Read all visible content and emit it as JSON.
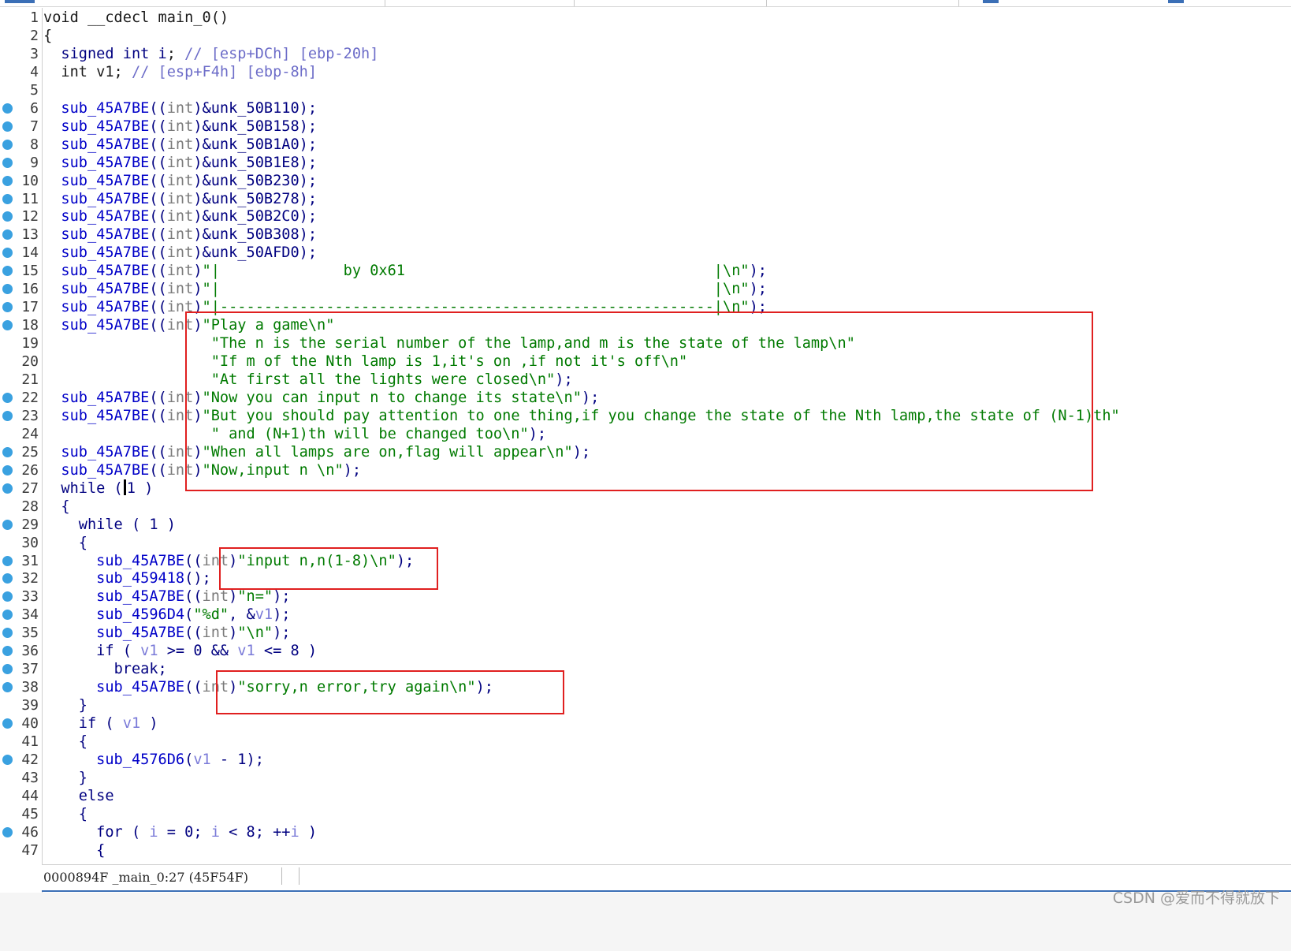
{
  "editor": {
    "lines": [
      {
        "n": "1",
        "bp": false,
        "t": [
          [
            "c-def",
            "void __cdecl main_0()"
          ]
        ]
      },
      {
        "n": "2",
        "bp": false,
        "t": [
          [
            "c-def",
            "{"
          ]
        ]
      },
      {
        "n": "3",
        "bp": false,
        "t": [
          [
            "c-def",
            "  "
          ],
          [
            "c-kw",
            "signed int i"
          ],
          [
            "c-def",
            "; "
          ],
          [
            "c-cm",
            "// [esp+DCh] [ebp-20h]"
          ]
        ]
      },
      {
        "n": "4",
        "bp": false,
        "t": [
          [
            "c-def",
            "  int v1; "
          ],
          [
            "c-cm",
            "// [esp+F4h] [ebp-8h]"
          ]
        ]
      },
      {
        "n": "5",
        "bp": false,
        "t": [
          [
            "c-def",
            ""
          ]
        ]
      },
      {
        "n": "6",
        "bp": true,
        "t": [
          [
            "c-def",
            "  "
          ],
          [
            "c-fn",
            "sub_45A7BE"
          ],
          [
            "c-kw",
            "(("
          ],
          [
            "c-tp",
            "int"
          ],
          [
            "c-kw",
            ")&unk_50B110);"
          ]
        ]
      },
      {
        "n": "7",
        "bp": true,
        "t": [
          [
            "c-def",
            "  "
          ],
          [
            "c-fn",
            "sub_45A7BE"
          ],
          [
            "c-kw",
            "(("
          ],
          [
            "c-tp",
            "int"
          ],
          [
            "c-kw",
            ")&unk_50B158);"
          ]
        ]
      },
      {
        "n": "8",
        "bp": true,
        "t": [
          [
            "c-def",
            "  "
          ],
          [
            "c-fn",
            "sub_45A7BE"
          ],
          [
            "c-kw",
            "(("
          ],
          [
            "c-tp",
            "int"
          ],
          [
            "c-kw",
            ")&unk_50B1A0);"
          ]
        ]
      },
      {
        "n": "9",
        "bp": true,
        "t": [
          [
            "c-def",
            "  "
          ],
          [
            "c-fn",
            "sub_45A7BE"
          ],
          [
            "c-kw",
            "(("
          ],
          [
            "c-tp",
            "int"
          ],
          [
            "c-kw",
            ")&unk_50B1E8);"
          ]
        ]
      },
      {
        "n": "10",
        "bp": true,
        "t": [
          [
            "c-def",
            "  "
          ],
          [
            "c-fn",
            "sub_45A7BE"
          ],
          [
            "c-kw",
            "(("
          ],
          [
            "c-tp",
            "int"
          ],
          [
            "c-kw",
            ")&unk_50B230);"
          ]
        ]
      },
      {
        "n": "11",
        "bp": true,
        "t": [
          [
            "c-def",
            "  "
          ],
          [
            "c-fn",
            "sub_45A7BE"
          ],
          [
            "c-kw",
            "(("
          ],
          [
            "c-tp",
            "int"
          ],
          [
            "c-kw",
            ")&unk_50B278);"
          ]
        ]
      },
      {
        "n": "12",
        "bp": true,
        "t": [
          [
            "c-def",
            "  "
          ],
          [
            "c-fn",
            "sub_45A7BE"
          ],
          [
            "c-kw",
            "(("
          ],
          [
            "c-tp",
            "int"
          ],
          [
            "c-kw",
            ")&unk_50B2C0);"
          ]
        ]
      },
      {
        "n": "13",
        "bp": true,
        "t": [
          [
            "c-def",
            "  "
          ],
          [
            "c-fn",
            "sub_45A7BE"
          ],
          [
            "c-kw",
            "(("
          ],
          [
            "c-tp",
            "int"
          ],
          [
            "c-kw",
            ")&unk_50B308);"
          ]
        ]
      },
      {
        "n": "14",
        "bp": true,
        "t": [
          [
            "c-def",
            "  "
          ],
          [
            "c-fn",
            "sub_45A7BE"
          ],
          [
            "c-kw",
            "(("
          ],
          [
            "c-tp",
            "int"
          ],
          [
            "c-kw",
            ")&unk_50AFD0);"
          ]
        ]
      },
      {
        "n": "15",
        "bp": true,
        "t": [
          [
            "c-def",
            "  "
          ],
          [
            "c-fn",
            "sub_45A7BE"
          ],
          [
            "c-kw",
            "(("
          ],
          [
            "c-tp",
            "int"
          ],
          [
            "c-kw",
            ")"
          ],
          [
            "c-st",
            "\"|              by 0x61                                   |\\n\""
          ],
          [
            "c-kw",
            ");"
          ]
        ]
      },
      {
        "n": "16",
        "bp": true,
        "t": [
          [
            "c-def",
            "  "
          ],
          [
            "c-fn",
            "sub_45A7BE"
          ],
          [
            "c-kw",
            "(("
          ],
          [
            "c-tp",
            "int"
          ],
          [
            "c-kw",
            ")"
          ],
          [
            "c-st",
            "\"|                                                        |\\n\""
          ],
          [
            "c-kw",
            ");"
          ]
        ]
      },
      {
        "n": "17",
        "bp": true,
        "t": [
          [
            "c-def",
            "  "
          ],
          [
            "c-fn",
            "sub_45A7BE"
          ],
          [
            "c-kw",
            "(("
          ],
          [
            "c-tp",
            "int"
          ],
          [
            "c-kw",
            ")"
          ],
          [
            "c-st",
            "\"|--------------------------------------------------------|\\n\""
          ],
          [
            "c-kw",
            ");"
          ]
        ]
      },
      {
        "n": "18",
        "bp": true,
        "t": [
          [
            "c-def",
            "  "
          ],
          [
            "c-fn",
            "sub_45A7BE"
          ],
          [
            "c-kw",
            "(("
          ],
          [
            "c-tp",
            "int"
          ],
          [
            "c-kw",
            ")"
          ],
          [
            "c-st",
            "\"Play a game\\n\""
          ]
        ]
      },
      {
        "n": "19",
        "bp": false,
        "t": [
          [
            "c-def",
            "                   "
          ],
          [
            "c-st",
            "\"The n is the serial number of the lamp,and m is the state of the lamp\\n\""
          ]
        ]
      },
      {
        "n": "20",
        "bp": false,
        "t": [
          [
            "c-def",
            "                   "
          ],
          [
            "c-st",
            "\"If m of the Nth lamp is 1,it's on ,if not it's off\\n\""
          ]
        ]
      },
      {
        "n": "21",
        "bp": false,
        "t": [
          [
            "c-def",
            "                   "
          ],
          [
            "c-st",
            "\"At first all the lights were closed\\n\""
          ],
          [
            "c-kw",
            ");"
          ]
        ]
      },
      {
        "n": "22",
        "bp": true,
        "t": [
          [
            "c-def",
            "  "
          ],
          [
            "c-fn",
            "sub_45A7BE"
          ],
          [
            "c-kw",
            "(("
          ],
          [
            "c-tp",
            "int"
          ],
          [
            "c-kw",
            ")"
          ],
          [
            "c-st",
            "\"Now you can input n to change its state\\n\""
          ],
          [
            "c-kw",
            ");"
          ]
        ]
      },
      {
        "n": "23",
        "bp": true,
        "t": [
          [
            "c-def",
            "  "
          ],
          [
            "c-fn",
            "sub_45A7BE"
          ],
          [
            "c-kw",
            "(("
          ],
          [
            "c-tp",
            "int"
          ],
          [
            "c-kw",
            ")"
          ],
          [
            "c-st",
            "\"But you should pay attention to one thing,if you change the state of the Nth lamp,the state of (N-1)th\""
          ]
        ]
      },
      {
        "n": "24",
        "bp": false,
        "t": [
          [
            "c-def",
            "                   "
          ],
          [
            "c-st",
            "\" and (N+1)th will be changed too\\n\""
          ],
          [
            "c-kw",
            ");"
          ]
        ]
      },
      {
        "n": "25",
        "bp": true,
        "t": [
          [
            "c-def",
            "  "
          ],
          [
            "c-fn",
            "sub_45A7BE"
          ],
          [
            "c-kw",
            "(("
          ],
          [
            "c-tp",
            "int"
          ],
          [
            "c-kw",
            ")"
          ],
          [
            "c-st",
            "\"When all lamps are on,flag will appear\\n\""
          ],
          [
            "c-kw",
            ");"
          ]
        ]
      },
      {
        "n": "26",
        "bp": true,
        "t": [
          [
            "c-def",
            "  "
          ],
          [
            "c-fn",
            "sub_45A7BE"
          ],
          [
            "c-kw",
            "(("
          ],
          [
            "c-tp",
            "int"
          ],
          [
            "c-kw",
            ")"
          ],
          [
            "c-st",
            "\"Now,input n \\n\""
          ],
          [
            "c-kw",
            ");"
          ]
        ]
      },
      {
        "n": "27",
        "bp": true,
        "cursor": true,
        "t": [
          [
            "c-def",
            "  "
          ],
          [
            "c-kw",
            "while ("
          ],
          [
            "cursor",
            ""
          ],
          [
            "c-kw",
            "1 )"
          ]
        ]
      },
      {
        "n": "28",
        "bp": false,
        "t": [
          [
            "c-def",
            "  "
          ],
          [
            "c-kw",
            "{"
          ]
        ]
      },
      {
        "n": "29",
        "bp": true,
        "t": [
          [
            "c-def",
            "    "
          ],
          [
            "c-kw",
            "while ( 1 )"
          ]
        ]
      },
      {
        "n": "30",
        "bp": false,
        "t": [
          [
            "c-def",
            "    "
          ],
          [
            "c-kw",
            "{"
          ]
        ]
      },
      {
        "n": "31",
        "bp": true,
        "t": [
          [
            "c-def",
            "      "
          ],
          [
            "c-fn",
            "sub_45A7BE"
          ],
          [
            "c-kw",
            "(("
          ],
          [
            "c-tp",
            "int"
          ],
          [
            "c-kw",
            ")"
          ],
          [
            "c-st",
            "\"input n,n(1-8)\\n\""
          ],
          [
            "c-kw",
            ");"
          ]
        ]
      },
      {
        "n": "32",
        "bp": true,
        "t": [
          [
            "c-def",
            "      "
          ],
          [
            "c-fn",
            "sub_459418"
          ],
          [
            "c-kw",
            "();"
          ]
        ]
      },
      {
        "n": "33",
        "bp": true,
        "t": [
          [
            "c-def",
            "      "
          ],
          [
            "c-fn",
            "sub_45A7BE"
          ],
          [
            "c-kw",
            "(("
          ],
          [
            "c-tp",
            "int"
          ],
          [
            "c-kw",
            ")"
          ],
          [
            "c-st",
            "\"n=\""
          ],
          [
            "c-kw",
            ");"
          ]
        ]
      },
      {
        "n": "34",
        "bp": true,
        "t": [
          [
            "c-def",
            "      "
          ],
          [
            "c-fn",
            "sub_4596D4"
          ],
          [
            "c-kw",
            "("
          ],
          [
            "c-st",
            "\"%d\""
          ],
          [
            "c-kw",
            ", &"
          ],
          [
            "c-v",
            "v1"
          ],
          [
            "c-kw",
            ");"
          ]
        ]
      },
      {
        "n": "35",
        "bp": true,
        "t": [
          [
            "c-def",
            "      "
          ],
          [
            "c-fn",
            "sub_45A7BE"
          ],
          [
            "c-kw",
            "(("
          ],
          [
            "c-tp",
            "int"
          ],
          [
            "c-kw",
            ")"
          ],
          [
            "c-st",
            "\"\\n\""
          ],
          [
            "c-kw",
            ");"
          ]
        ]
      },
      {
        "n": "36",
        "bp": true,
        "t": [
          [
            "c-def",
            "      "
          ],
          [
            "c-kw",
            "if ( "
          ],
          [
            "c-v",
            "v1"
          ],
          [
            "c-kw",
            " >= 0 && "
          ],
          [
            "c-v",
            "v1"
          ],
          [
            "c-kw",
            " <= 8 )"
          ]
        ]
      },
      {
        "n": "37",
        "bp": true,
        "t": [
          [
            "c-def",
            "        "
          ],
          [
            "c-kw",
            "break;"
          ]
        ]
      },
      {
        "n": "38",
        "bp": true,
        "t": [
          [
            "c-def",
            "      "
          ],
          [
            "c-fn",
            "sub_45A7BE"
          ],
          [
            "c-kw",
            "(("
          ],
          [
            "c-tp",
            "int"
          ],
          [
            "c-kw",
            ")"
          ],
          [
            "c-st",
            "\"sorry,n error,try again\\n\""
          ],
          [
            "c-kw",
            ");"
          ]
        ]
      },
      {
        "n": "39",
        "bp": false,
        "t": [
          [
            "c-def",
            "    "
          ],
          [
            "c-kw",
            "}"
          ]
        ]
      },
      {
        "n": "40",
        "bp": true,
        "t": [
          [
            "c-def",
            "    "
          ],
          [
            "c-kw",
            "if ( "
          ],
          [
            "c-v",
            "v1"
          ],
          [
            "c-kw",
            " )"
          ]
        ]
      },
      {
        "n": "41",
        "bp": false,
        "t": [
          [
            "c-def",
            "    "
          ],
          [
            "c-kw",
            "{"
          ]
        ]
      },
      {
        "n": "42",
        "bp": true,
        "t": [
          [
            "c-def",
            "      "
          ],
          [
            "c-fn",
            "sub_4576D6"
          ],
          [
            "c-kw",
            "("
          ],
          [
            "c-v",
            "v1"
          ],
          [
            "c-kw",
            " - 1);"
          ]
        ]
      },
      {
        "n": "43",
        "bp": false,
        "t": [
          [
            "c-def",
            "    "
          ],
          [
            "c-kw",
            "}"
          ]
        ]
      },
      {
        "n": "44",
        "bp": false,
        "t": [
          [
            "c-def",
            "    "
          ],
          [
            "c-kw",
            "else"
          ]
        ]
      },
      {
        "n": "45",
        "bp": false,
        "t": [
          [
            "c-def",
            "    "
          ],
          [
            "c-kw",
            "{"
          ]
        ]
      },
      {
        "n": "46",
        "bp": true,
        "t": [
          [
            "c-def",
            "      "
          ],
          [
            "c-kw",
            "for ( "
          ],
          [
            "c-v",
            "i"
          ],
          [
            "c-kw",
            " = 0; "
          ],
          [
            "c-v",
            "i"
          ],
          [
            "c-kw",
            " < 8; ++"
          ],
          [
            "c-v",
            "i"
          ],
          [
            "c-kw",
            " )"
          ]
        ]
      },
      {
        "n": "47",
        "bp": false,
        "t": [
          [
            "c-def",
            "      "
          ],
          [
            "c-kw",
            "{"
          ]
        ]
      }
    ]
  },
  "status": {
    "text": "0000894F _main_0:27 (45F54F)"
  },
  "watermark": "CSDN @爱而不得就放下",
  "colors": {
    "highlight_box": "#e02020",
    "breakpoint": "#3aa1e0",
    "string": "#007a00",
    "function": "#0000c8"
  }
}
